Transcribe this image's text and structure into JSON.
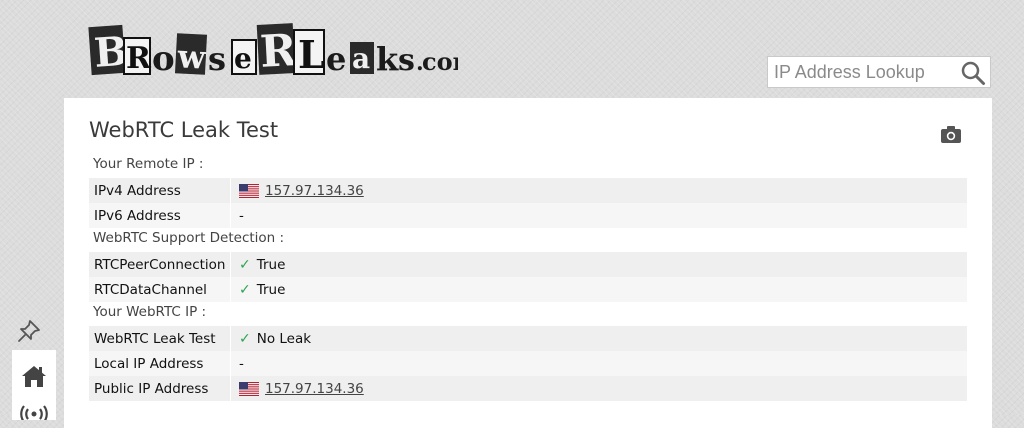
{
  "logo": {
    "text": "BrowserLeaks.com",
    "brand_color": "#1b1b1b"
  },
  "search": {
    "placeholder": "IP Address Lookup",
    "icon": "search-icon"
  },
  "page": {
    "title": "WebRTC Leak Test",
    "camera_icon": "camera-icon"
  },
  "sections": [
    {
      "label": "Your Remote IP :",
      "rows": [
        {
          "key": "IPv4 Address",
          "value": "157.97.134.36",
          "link": true,
          "flag": "us"
        },
        {
          "key": "IPv6 Address",
          "value": "-"
        }
      ]
    },
    {
      "label": "WebRTC Support Detection :",
      "rows": [
        {
          "key": "RTCPeerConnection",
          "value": "True",
          "check": true
        },
        {
          "key": "RTCDataChannel",
          "value": "True",
          "check": true
        }
      ]
    },
    {
      "label": "Your WebRTC IP :",
      "rows": [
        {
          "key": "WebRTC Leak Test",
          "value": "No Leak",
          "check": true
        },
        {
          "key": "Local IP Address",
          "value": "-"
        },
        {
          "key": "Public IP Address",
          "value": "157.97.134.36",
          "link": true,
          "flag": "us"
        }
      ]
    }
  ],
  "sidebar": {
    "items": [
      "pin-icon",
      "home-icon",
      "broadcast-icon"
    ]
  },
  "colors": {
    "check": "#2ea44f",
    "row_bg": "#efefef",
    "panel_bg": "#ffffff"
  }
}
